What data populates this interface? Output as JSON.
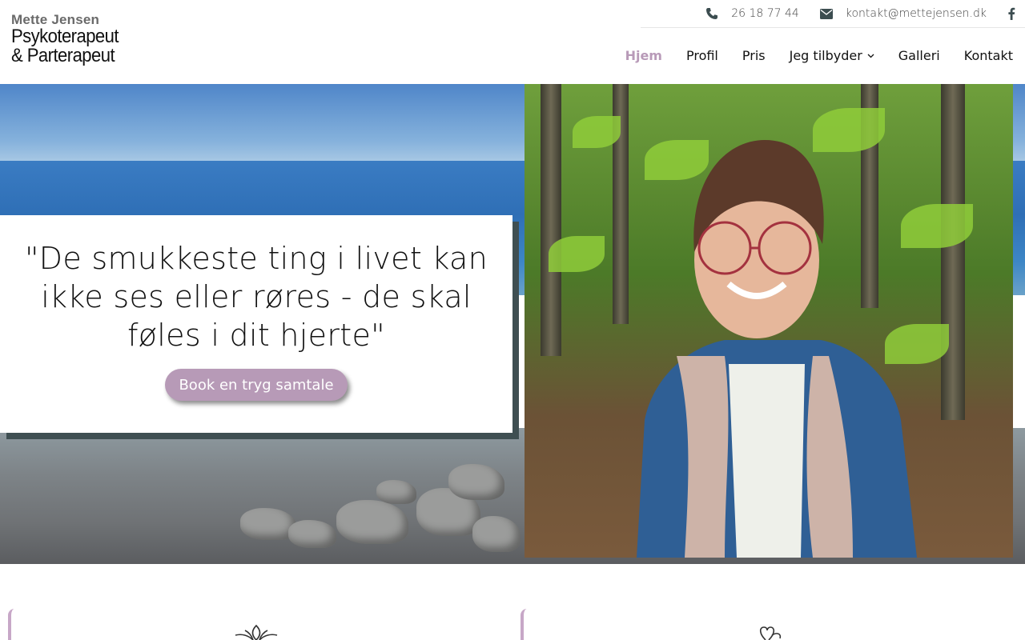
{
  "logo": {
    "line1": "Mette Jensen",
    "line2": "Psykoterapeut",
    "line3": "& Parterapeut"
  },
  "topbar": {
    "phone": "26 18 77 44",
    "email": "kontakt@mettejensen.dk",
    "phone_icon": "phone-icon",
    "email_icon": "envelope-icon",
    "social_icon": "facebook-icon"
  },
  "nav": {
    "items": [
      {
        "label": "Hjem",
        "active": true
      },
      {
        "label": "Profil"
      },
      {
        "label": "Pris"
      },
      {
        "label": "Jeg tilbyder",
        "has_dropdown": true
      },
      {
        "label": "Galleri"
      },
      {
        "label": "Kontakt"
      }
    ]
  },
  "hero": {
    "quote": "\"De smukkeste ting i livet kan ikke ses eller røres - de skal føles i dit hjerte\"",
    "button_label": "Book en tryg samtale"
  },
  "colors": {
    "accent": "#b79ab7",
    "active_nav": "#b89ab8",
    "box_shadow": "#3f4f52"
  }
}
